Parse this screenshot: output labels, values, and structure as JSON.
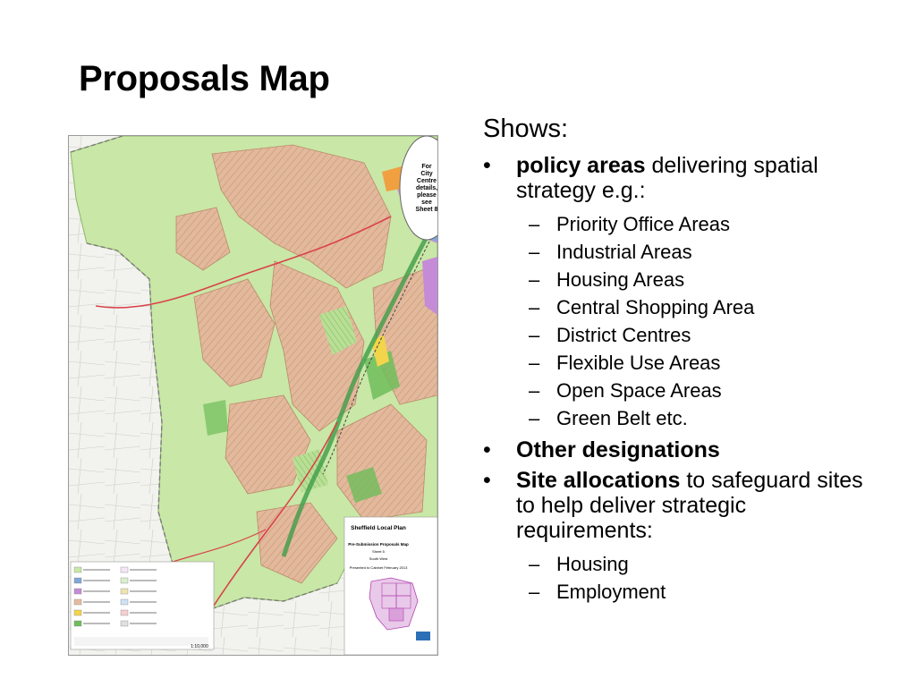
{
  "slide": {
    "title": "Proposals Map",
    "intro": "Shows:"
  },
  "bullets": [
    {
      "bold": "policy areas",
      "text": " delivering spatial strategy e.g.:",
      "subitems": [
        "Priority Office Areas",
        "Industrial Areas",
        "Housing Areas",
        "Central Shopping Area",
        "District Centres",
        "Flexible Use Areas",
        "Open Space Areas",
        "Green Belt etc."
      ]
    },
    {
      "bold": "Other designations",
      "text": "",
      "subitems": []
    },
    {
      "bold": "Site allocations",
      "text": " to safeguard sites to help deliver strategic requirements:",
      "subitems": [
        "Housing",
        "Employment"
      ]
    }
  ],
  "map": {
    "callout": [
      "For",
      "City",
      "Centre",
      "details,",
      "please",
      "see",
      "Sheet 8"
    ],
    "panel_header": "Sheffield Local Plan",
    "panel_title": "Pre-Submission Proposals Map",
    "panel_sheet": "Sheet 5",
    "panel_area": "South West",
    "panel_presented": "Presented to Cabinet February 2013",
    "scale": "1:10,000",
    "colors": {
      "green_belt": "#c9e7a6",
      "housing": "#e6bca0",
      "open_space": "#6ebd5a",
      "industrial": "#c58bd6",
      "office": "#7fa7d8",
      "shopping": "#f2d54a",
      "boundary_road": "#d9434b"
    }
  }
}
